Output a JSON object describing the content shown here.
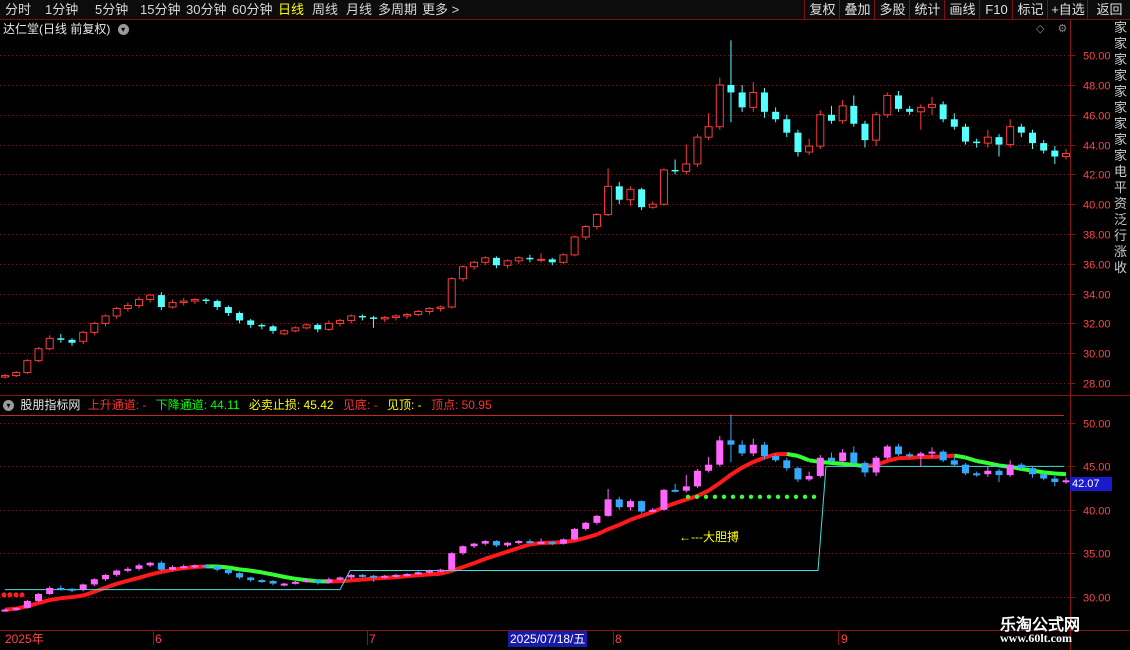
{
  "toolbar": {
    "periods": [
      "分时",
      "1分钟",
      "5分钟",
      "15分钟",
      "30分钟",
      "60分钟",
      "日线",
      "周线",
      "月线",
      "多周期",
      "更多 >"
    ],
    "active_period": "日线",
    "actions": [
      "复权",
      "叠加",
      "多股",
      "统计",
      "画线",
      "F10",
      "标记",
      "+自选",
      "返回"
    ]
  },
  "main_panel": {
    "title": "达仁堂(日线 前复权)",
    "y_ticks": [
      "50.00",
      "48.00",
      "46.00",
      "44.00",
      "42.00",
      "40.00",
      "38.00",
      "36.00",
      "34.00",
      "32.00",
      "30.00",
      "28.00"
    ],
    "candles": [
      [
        28.4,
        28.5,
        28.3,
        28.6
      ],
      [
        28.5,
        28.7,
        28.4,
        28.8
      ],
      [
        28.7,
        29.5,
        28.6,
        29.6
      ],
      [
        29.5,
        30.3,
        29.4,
        30.4
      ],
      [
        30.3,
        31.0,
        30.2,
        31.2
      ],
      [
        31.0,
        30.9,
        30.7,
        31.3
      ],
      [
        30.9,
        30.7,
        30.5,
        31.0
      ],
      [
        30.8,
        31.4,
        30.6,
        31.5
      ],
      [
        31.4,
        32.0,
        31.2,
        32.1
      ],
      [
        32.0,
        32.5,
        31.8,
        32.6
      ],
      [
        32.5,
        33.0,
        32.3,
        33.1
      ],
      [
        33.0,
        33.2,
        32.8,
        33.4
      ],
      [
        33.2,
        33.6,
        33.0,
        33.8
      ],
      [
        33.6,
        33.9,
        33.4,
        34.0
      ],
      [
        33.9,
        33.1,
        32.9,
        34.1
      ],
      [
        33.1,
        33.4,
        33.0,
        33.6
      ],
      [
        33.4,
        33.5,
        33.2,
        33.7
      ],
      [
        33.5,
        33.6,
        33.3,
        33.7
      ],
      [
        33.6,
        33.5,
        33.3,
        33.7
      ],
      [
        33.5,
        33.1,
        32.9,
        33.6
      ],
      [
        33.1,
        32.7,
        32.5,
        33.2
      ],
      [
        32.7,
        32.2,
        32.0,
        32.8
      ],
      [
        32.2,
        31.9,
        31.7,
        32.3
      ],
      [
        31.9,
        31.8,
        31.6,
        32.0
      ],
      [
        31.8,
        31.5,
        31.3,
        31.9
      ],
      [
        31.3,
        31.5,
        31.2,
        31.6
      ],
      [
        31.5,
        31.7,
        31.4,
        31.8
      ],
      [
        31.7,
        31.9,
        31.6,
        32.0
      ],
      [
        31.9,
        31.6,
        31.4,
        32.0
      ],
      [
        31.6,
        32.0,
        31.5,
        32.2
      ],
      [
        32.0,
        32.2,
        31.8,
        32.3
      ],
      [
        32.2,
        32.5,
        32.0,
        32.6
      ],
      [
        32.5,
        32.4,
        32.2,
        32.6
      ],
      [
        32.4,
        32.3,
        31.7,
        32.5
      ],
      [
        32.3,
        32.4,
        32.1,
        32.5
      ],
      [
        32.4,
        32.5,
        32.2,
        32.6
      ],
      [
        32.5,
        32.6,
        32.3,
        32.7
      ],
      [
        32.6,
        32.8,
        32.5,
        32.9
      ],
      [
        32.8,
        33.0,
        32.6,
        33.1
      ],
      [
        33.0,
        33.1,
        32.8,
        33.2
      ],
      [
        33.1,
        35.0,
        33.0,
        35.1
      ],
      [
        35.0,
        35.8,
        34.8,
        35.9
      ],
      [
        35.8,
        36.1,
        35.6,
        36.2
      ],
      [
        36.1,
        36.4,
        35.9,
        36.5
      ],
      [
        36.4,
        35.9,
        35.7,
        36.5
      ],
      [
        35.9,
        36.2,
        35.7,
        36.3
      ],
      [
        36.2,
        36.4,
        36.0,
        36.5
      ],
      [
        36.4,
        36.3,
        36.1,
        36.6
      ],
      [
        36.3,
        36.3,
        36.1,
        36.7
      ],
      [
        36.3,
        36.1,
        35.9,
        36.4
      ],
      [
        36.1,
        36.6,
        36.0,
        36.7
      ],
      [
        36.6,
        37.8,
        36.5,
        37.9
      ],
      [
        37.8,
        38.5,
        37.6,
        38.6
      ],
      [
        38.5,
        39.3,
        38.3,
        39.4
      ],
      [
        39.3,
        41.2,
        39.2,
        42.4
      ],
      [
        41.2,
        40.3,
        40.0,
        41.5
      ],
      [
        40.3,
        41.0,
        39.9,
        41.2
      ],
      [
        41.0,
        39.8,
        39.6,
        41.1
      ],
      [
        39.8,
        40.0,
        39.7,
        40.2
      ],
      [
        40.0,
        42.3,
        39.9,
        42.4
      ],
      [
        42.3,
        42.2,
        42.0,
        43.0
      ],
      [
        42.2,
        42.7,
        42.0,
        44.0
      ],
      [
        42.7,
        44.5,
        42.5,
        44.7
      ],
      [
        44.5,
        45.2,
        44.3,
        46.1
      ],
      [
        45.2,
        48.0,
        45.0,
        48.5
      ],
      [
        48.0,
        47.5,
        45.5,
        51.0
      ],
      [
        47.5,
        46.5,
        46.2,
        48.0
      ],
      [
        46.5,
        47.5,
        46.2,
        48.2
      ],
      [
        47.5,
        46.2,
        45.8,
        47.8
      ],
      [
        46.2,
        45.7,
        45.5,
        46.5
      ],
      [
        45.7,
        44.8,
        44.5,
        46.0
      ],
      [
        44.8,
        43.5,
        43.2,
        45.0
      ],
      [
        43.5,
        43.9,
        43.3,
        44.4
      ],
      [
        43.9,
        46.0,
        43.7,
        46.3
      ],
      [
        46.0,
        45.6,
        45.4,
        46.6
      ],
      [
        45.6,
        46.6,
        45.4,
        47.0
      ],
      [
        46.6,
        45.4,
        45.2,
        47.3
      ],
      [
        45.4,
        44.3,
        43.8,
        45.6
      ],
      [
        44.3,
        46.0,
        43.9,
        46.2
      ],
      [
        46.0,
        47.3,
        45.8,
        47.5
      ],
      [
        47.3,
        46.4,
        46.2,
        47.6
      ],
      [
        46.4,
        46.2,
        46.0,
        46.6
      ],
      [
        46.2,
        46.5,
        45.0,
        46.7
      ],
      [
        46.5,
        46.7,
        46.0,
        47.2
      ],
      [
        46.7,
        45.7,
        45.5,
        46.9
      ],
      [
        45.7,
        45.2,
        45.0,
        46.1
      ],
      [
        45.2,
        44.2,
        44.0,
        45.4
      ],
      [
        44.2,
        44.1,
        43.8,
        44.4
      ],
      [
        44.1,
        44.5,
        43.8,
        45.0
      ],
      [
        44.5,
        44.0,
        43.2,
        44.7
      ],
      [
        44.0,
        45.2,
        43.8,
        45.7
      ],
      [
        45.2,
        44.8,
        44.5,
        45.4
      ],
      [
        44.8,
        44.1,
        43.7,
        45.0
      ],
      [
        44.1,
        43.6,
        43.4,
        44.3
      ],
      [
        43.6,
        43.2,
        42.7,
        43.9
      ],
      [
        43.2,
        43.4,
        43.0,
        43.7
      ]
    ]
  },
  "indicator_panel": {
    "name": "股朋指标网",
    "labels": [
      {
        "text": "上升通道: -",
        "color": "#ff3030"
      },
      {
        "text": "下降通道: 44.11",
        "color": "#00ff00"
      },
      {
        "text": "必卖止损: 45.42",
        "color": "#ffff00"
      },
      {
        "text": "见底: -",
        "color": "#ff3030"
      },
      {
        "text": "见顶: -",
        "color": "#ffff00"
      },
      {
        "text": "顶点: 50.95",
        "color": "#ff3030"
      }
    ],
    "y_ticks": [
      "50.00",
      "45.00",
      "40.00",
      "35.00",
      "30.00"
    ],
    "current_price": "42.07",
    "annotation": "←---大胆搏",
    "colors": {
      "up_channel": "#ff1a1a",
      "down_channel": "#33ff33",
      "candle_up": "#ff66ff",
      "candle_down": "#33aaff",
      "support": "#40e0e0"
    }
  },
  "date_axis": {
    "labels": [
      "2025年",
      "6",
      "7",
      "2025/07/18/五",
      "8",
      "9"
    ],
    "highlight": "2025/07/18/五"
  },
  "watermark": {
    "line1": "乐淘公式网",
    "line2": "www.60lt.com"
  },
  "right_strip_text": "家家家家家家家家家电平资泛行涨收"
}
